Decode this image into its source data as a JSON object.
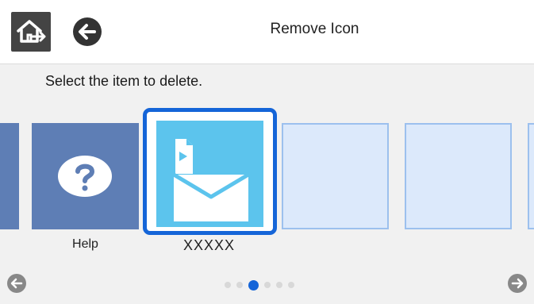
{
  "header": {
    "title": "Remove Icon",
    "home_icon": "home-icon",
    "back_icon": "back-arrow-icon"
  },
  "instruction": "Select the item to delete.",
  "items": [
    {
      "label": "",
      "icon": "partial-tile",
      "color": "#5e7eb5"
    },
    {
      "label": "Help",
      "icon": "help-question-icon",
      "color": "#5e7eb5"
    },
    {
      "label": "XXXXX",
      "icon": "scan-to-email-icon",
      "color": "#5cc4ed",
      "selected": true
    },
    {
      "label": "",
      "icon": "empty-slot",
      "color": "#dce9fb"
    },
    {
      "label": "",
      "icon": "empty-slot",
      "color": "#dce9fb"
    }
  ],
  "pagination": {
    "total": 6,
    "current": 3
  },
  "colors": {
    "accent": "#1565d8",
    "help_tile": "#5e7eb5",
    "scan_tile": "#5cc4ed",
    "empty_tile": "#dce9fb",
    "background": "#f1f1f1"
  },
  "nav": {
    "prev_icon": "arrow-left-circle-icon",
    "next_icon": "arrow-right-circle-icon"
  }
}
